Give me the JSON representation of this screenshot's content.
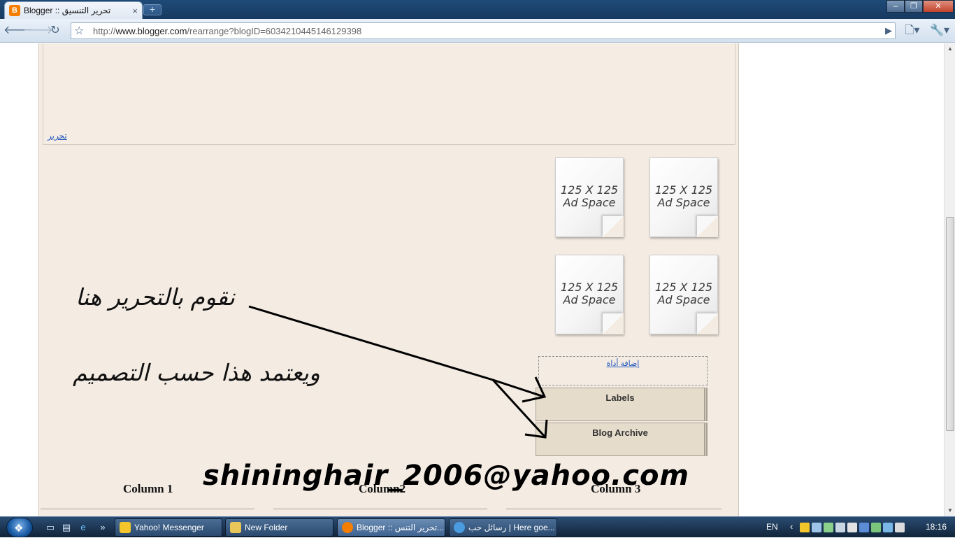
{
  "browser": {
    "tab_title": "Blogger :: تحرير التنسيق",
    "tab_favicon": "B",
    "tab_close": "×",
    "new_tab": "+",
    "url_host": "www.blogger.com",
    "url_prefix": "http://",
    "url_path": "/rearrange?blogID=6034210445146129398",
    "back_icon": "arrow-left",
    "forward_icon": "arrow-right",
    "reload_icon": "reload",
    "star_icon": "star",
    "go_icon": "play",
    "page_menu_icon": "page-menu",
    "wrench_icon": "wrench"
  },
  "page": {
    "header_edit_link": "تحرير",
    "ad_boxes": [
      {
        "line1": "125 X 125",
        "line2": "Ad Space"
      },
      {
        "line1": "125 X 125",
        "line2": "Ad Space"
      },
      {
        "line1": "125 X 125",
        "line2": "Ad Space"
      },
      {
        "line1": "125 X 125",
        "line2": "Ad Space"
      }
    ],
    "add_gadget": "إضافة أداة",
    "gadgets": [
      {
        "label": "Labels"
      },
      {
        "label": "Blog Archive"
      }
    ],
    "columns": [
      "Column 1",
      "Column2",
      "Column 3"
    ]
  },
  "overlay": {
    "annotation_line1": "نقوم بالتحرير هنا",
    "annotation_line2": "ويعتمد هذا حسب التصميم",
    "email": "shininghair_2006@yahoo.com"
  },
  "taskbar": {
    "items": [
      {
        "label": "Yahoo! Messenger",
        "icon_color": "#f3c62c"
      },
      {
        "label": "New Folder",
        "icon_color": "#e7c65a"
      },
      {
        "label": "Blogger :: تحرير التنس...",
        "icon_color": "#f57d00",
        "active": true
      },
      {
        "label": "رسائل حب | Here goe...",
        "icon_color": "#4a9be0"
      }
    ],
    "language": "EN",
    "clock": "18:16"
  },
  "colors": {
    "canvas_bg": "#f4ece3",
    "gadget_bg": "#e6dccb",
    "link": "#2255bb"
  }
}
